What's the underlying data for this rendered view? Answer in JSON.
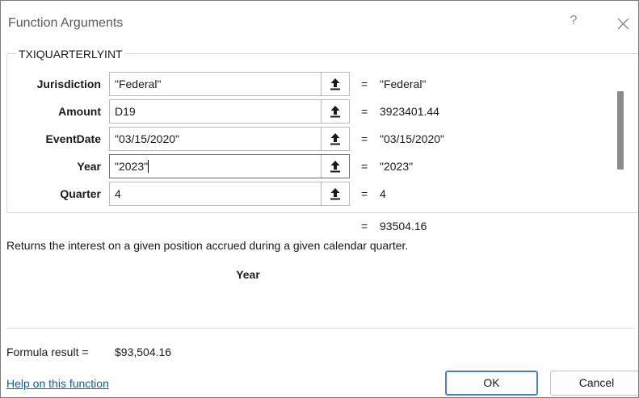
{
  "dialog": {
    "title": "Function Arguments",
    "help_label": "?",
    "function_name": "TXIQUARTERLYINT",
    "arguments": [
      {
        "label": "Jurisdiction",
        "value": "\"Federal\"",
        "evaluated": "\"Federal\""
      },
      {
        "label": "Amount",
        "value": "D19",
        "evaluated": "3923401.44"
      },
      {
        "label": "EventDate",
        "value": "\"03/15/2020\"",
        "evaluated": "\"03/15/2020\""
      },
      {
        "label": "Year",
        "value": "\"2023\"",
        "evaluated": "\"2023\"",
        "focused": true
      },
      {
        "label": "Quarter",
        "value": "4",
        "evaluated": "4"
      }
    ],
    "equals_sign": "=",
    "function_result": "93504.16",
    "description": "Returns the interest on a given position accrued during a given calendar quarter.",
    "focused_argument": "Year",
    "formula_result_label": "Formula result =",
    "formula_result_value": "$93,504.16",
    "help_link": "Help on this function",
    "ok_label": "OK",
    "cancel_label": "Cancel"
  },
  "colors": {
    "link": "#0060b0",
    "ok_border": "#4a7fc4",
    "scrollbar_thumb": "#8c8c8c"
  },
  "icons": {
    "collapse": "upload-arrow-icon",
    "close": "close-icon"
  }
}
